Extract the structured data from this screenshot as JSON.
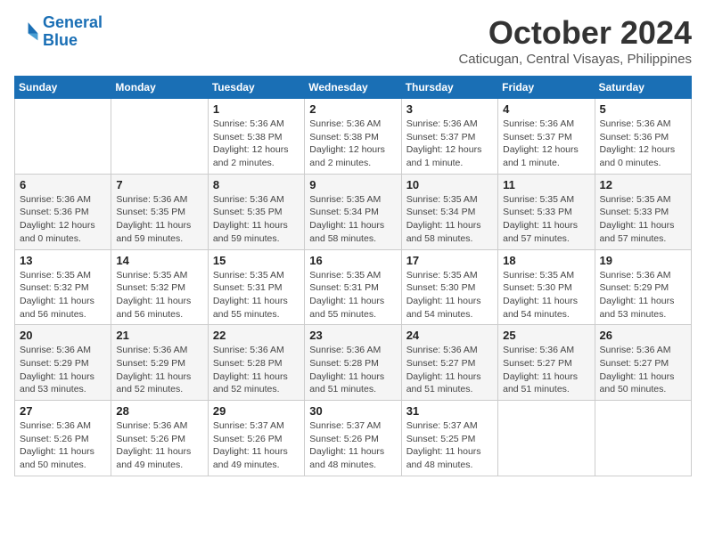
{
  "logo": {
    "line1": "General",
    "line2": "Blue"
  },
  "title": "October 2024",
  "location": "Caticugan, Central Visayas, Philippines",
  "weekdays": [
    "Sunday",
    "Monday",
    "Tuesday",
    "Wednesday",
    "Thursday",
    "Friday",
    "Saturday"
  ],
  "weeks": [
    [
      null,
      null,
      {
        "day": "1",
        "sunrise": "5:36 AM",
        "sunset": "5:38 PM",
        "daylight": "12 hours and 2 minutes."
      },
      {
        "day": "2",
        "sunrise": "5:36 AM",
        "sunset": "5:38 PM",
        "daylight": "12 hours and 2 minutes."
      },
      {
        "day": "3",
        "sunrise": "5:36 AM",
        "sunset": "5:37 PM",
        "daylight": "12 hours and 1 minute."
      },
      {
        "day": "4",
        "sunrise": "5:36 AM",
        "sunset": "5:37 PM",
        "daylight": "12 hours and 1 minute."
      },
      {
        "day": "5",
        "sunrise": "5:36 AM",
        "sunset": "5:36 PM",
        "daylight": "12 hours and 0 minutes."
      }
    ],
    [
      {
        "day": "6",
        "sunrise": "5:36 AM",
        "sunset": "5:36 PM",
        "daylight": "12 hours and 0 minutes."
      },
      {
        "day": "7",
        "sunrise": "5:36 AM",
        "sunset": "5:35 PM",
        "daylight": "11 hours and 59 minutes."
      },
      {
        "day": "8",
        "sunrise": "5:36 AM",
        "sunset": "5:35 PM",
        "daylight": "11 hours and 59 minutes."
      },
      {
        "day": "9",
        "sunrise": "5:35 AM",
        "sunset": "5:34 PM",
        "daylight": "11 hours and 58 minutes."
      },
      {
        "day": "10",
        "sunrise": "5:35 AM",
        "sunset": "5:34 PM",
        "daylight": "11 hours and 58 minutes."
      },
      {
        "day": "11",
        "sunrise": "5:35 AM",
        "sunset": "5:33 PM",
        "daylight": "11 hours and 57 minutes."
      },
      {
        "day": "12",
        "sunrise": "5:35 AM",
        "sunset": "5:33 PM",
        "daylight": "11 hours and 57 minutes."
      }
    ],
    [
      {
        "day": "13",
        "sunrise": "5:35 AM",
        "sunset": "5:32 PM",
        "daylight": "11 hours and 56 minutes."
      },
      {
        "day": "14",
        "sunrise": "5:35 AM",
        "sunset": "5:32 PM",
        "daylight": "11 hours and 56 minutes."
      },
      {
        "day": "15",
        "sunrise": "5:35 AM",
        "sunset": "5:31 PM",
        "daylight": "11 hours and 55 minutes."
      },
      {
        "day": "16",
        "sunrise": "5:35 AM",
        "sunset": "5:31 PM",
        "daylight": "11 hours and 55 minutes."
      },
      {
        "day": "17",
        "sunrise": "5:35 AM",
        "sunset": "5:30 PM",
        "daylight": "11 hours and 54 minutes."
      },
      {
        "day": "18",
        "sunrise": "5:35 AM",
        "sunset": "5:30 PM",
        "daylight": "11 hours and 54 minutes."
      },
      {
        "day": "19",
        "sunrise": "5:36 AM",
        "sunset": "5:29 PM",
        "daylight": "11 hours and 53 minutes."
      }
    ],
    [
      {
        "day": "20",
        "sunrise": "5:36 AM",
        "sunset": "5:29 PM",
        "daylight": "11 hours and 53 minutes."
      },
      {
        "day": "21",
        "sunrise": "5:36 AM",
        "sunset": "5:29 PM",
        "daylight": "11 hours and 52 minutes."
      },
      {
        "day": "22",
        "sunrise": "5:36 AM",
        "sunset": "5:28 PM",
        "daylight": "11 hours and 52 minutes."
      },
      {
        "day": "23",
        "sunrise": "5:36 AM",
        "sunset": "5:28 PM",
        "daylight": "11 hours and 51 minutes."
      },
      {
        "day": "24",
        "sunrise": "5:36 AM",
        "sunset": "5:27 PM",
        "daylight": "11 hours and 51 minutes."
      },
      {
        "day": "25",
        "sunrise": "5:36 AM",
        "sunset": "5:27 PM",
        "daylight": "11 hours and 51 minutes."
      },
      {
        "day": "26",
        "sunrise": "5:36 AM",
        "sunset": "5:27 PM",
        "daylight": "11 hours and 50 minutes."
      }
    ],
    [
      {
        "day": "27",
        "sunrise": "5:36 AM",
        "sunset": "5:26 PM",
        "daylight": "11 hours and 50 minutes."
      },
      {
        "day": "28",
        "sunrise": "5:36 AM",
        "sunset": "5:26 PM",
        "daylight": "11 hours and 49 minutes."
      },
      {
        "day": "29",
        "sunrise": "5:37 AM",
        "sunset": "5:26 PM",
        "daylight": "11 hours and 49 minutes."
      },
      {
        "day": "30",
        "sunrise": "5:37 AM",
        "sunset": "5:26 PM",
        "daylight": "11 hours and 48 minutes."
      },
      {
        "day": "31",
        "sunrise": "5:37 AM",
        "sunset": "5:25 PM",
        "daylight": "11 hours and 48 minutes."
      },
      null,
      null
    ]
  ],
  "labels": {
    "sunrise": "Sunrise:",
    "sunset": "Sunset:",
    "daylight": "Daylight:"
  }
}
